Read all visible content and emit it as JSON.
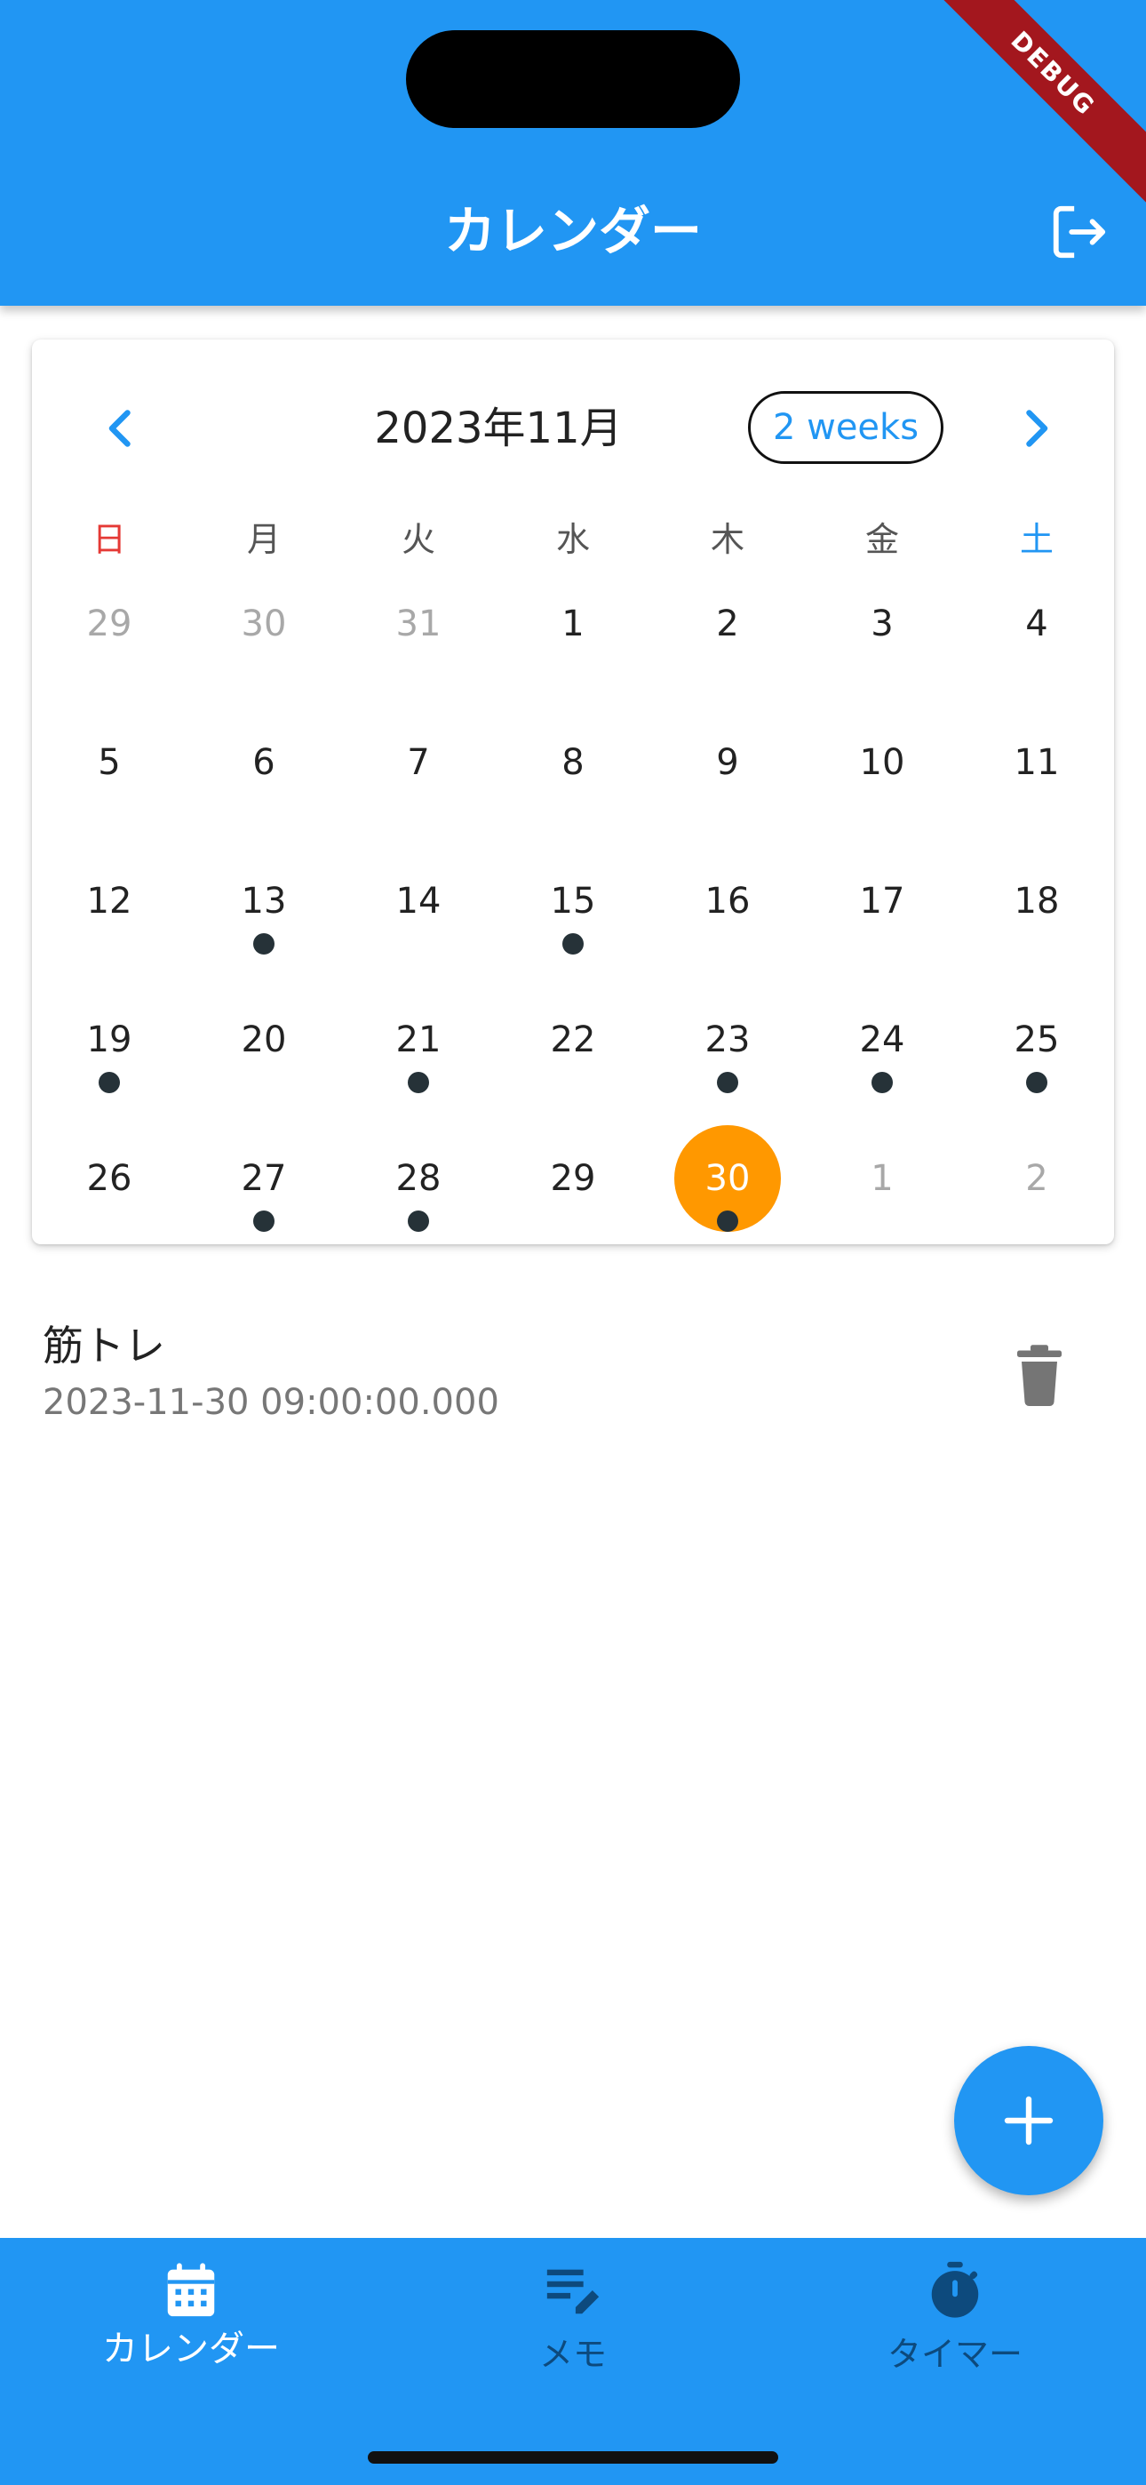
{
  "app_bar": {
    "title": "カレンダー",
    "debug_banner": "DEBUG",
    "logout_icon": "logout-icon"
  },
  "calendar": {
    "title": "2023年11月",
    "format_button": "2 weeks",
    "prev_icon": "chevron-left-icon",
    "next_icon": "chevron-right-icon",
    "weekdays": [
      "日",
      "月",
      "火",
      "水",
      "木",
      "金",
      "土"
    ],
    "weeks": [
      [
        {
          "d": "29",
          "out": true
        },
        {
          "d": "30",
          "out": true
        },
        {
          "d": "31",
          "out": true
        },
        {
          "d": "1"
        },
        {
          "d": "2"
        },
        {
          "d": "3"
        },
        {
          "d": "4"
        }
      ],
      [
        {
          "d": "5"
        },
        {
          "d": "6"
        },
        {
          "d": "7"
        },
        {
          "d": "8"
        },
        {
          "d": "9"
        },
        {
          "d": "10"
        },
        {
          "d": "11"
        }
      ],
      [
        {
          "d": "12"
        },
        {
          "d": "13",
          "ev": true
        },
        {
          "d": "14"
        },
        {
          "d": "15",
          "ev": true
        },
        {
          "d": "16"
        },
        {
          "d": "17"
        },
        {
          "d": "18"
        }
      ],
      [
        {
          "d": "19",
          "ev": true
        },
        {
          "d": "20"
        },
        {
          "d": "21",
          "ev": true
        },
        {
          "d": "22"
        },
        {
          "d": "23",
          "ev": true
        },
        {
          "d": "24",
          "ev": true
        },
        {
          "d": "25",
          "ev": true
        }
      ],
      [
        {
          "d": "26"
        },
        {
          "d": "27",
          "ev": true
        },
        {
          "d": "28",
          "ev": true
        },
        {
          "d": "29"
        },
        {
          "d": "30",
          "ev": true,
          "today": true
        },
        {
          "d": "1",
          "out": true
        },
        {
          "d": "2",
          "out": true
        }
      ]
    ],
    "colors": {
      "accent": "#2196F3",
      "today": "#FF9800",
      "sunday": "#E53935",
      "saturday": "#2196F3",
      "marker": "#263238"
    }
  },
  "events": [
    {
      "title": "筋トレ",
      "datetime": "2023-11-30 09:00:00.000",
      "delete_icon": "trash-icon"
    }
  ],
  "fab": {
    "icon": "plus-icon"
  },
  "bottom_nav": {
    "items": [
      {
        "label": "カレンダー",
        "icon": "calendar-icon",
        "active": true
      },
      {
        "label": "メモ",
        "icon": "notes-edit-icon",
        "active": false
      },
      {
        "label": "タイマー",
        "icon": "timer-icon",
        "active": false
      }
    ]
  }
}
